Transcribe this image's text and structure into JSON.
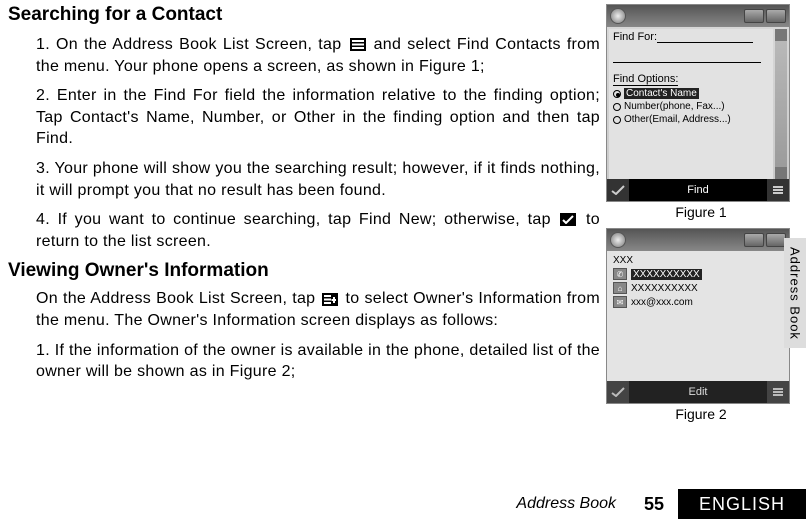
{
  "headings": {
    "searching": "Searching for a Contact",
    "viewing": "Viewing Owner's Information"
  },
  "searching_steps": {
    "s1a": "1. On the Address Book List Screen, tap",
    "s1b": "and select Find Contacts from the menu. Your phone opens a screen, as shown in Figure 1;",
    "s2": "2. Enter in the Find For field the information relative to the finding option; Tap Contact's Name, Number, or Other in the finding option and then tap Find.",
    "s3": "3. Your phone will show you the searching result; however, if it finds nothing, it will prompt you that no result has been found.",
    "s4a": "4. If you want to continue searching, tap Find New; otherwise, tap",
    "s4b": "to return to the list screen."
  },
  "viewing": {
    "p1a": "On the Address Book List Screen, tap",
    "p1b": "to select Owner's Information from the menu. The Owner's Information screen displays as follows:",
    "s1": "1. If the information of the owner is available in the phone, detailed list of the owner will be shown as in Figure 2;"
  },
  "fig1": {
    "find_for_label": "Find For:",
    "find_options_label": "Find Options:",
    "opt1": "Contact's Name",
    "opt2": "Number(phone, Fax...)",
    "opt3": "Other(Email, Address...)",
    "find_btn": "Find",
    "caption": "Figure 1"
  },
  "fig2": {
    "name": "XXX",
    "phone1": "XXXXXXXXXX",
    "phone2": "XXXXXXXXXX",
    "email": "xxx@xxx.com",
    "edit_btn": "Edit",
    "caption": "Figure 2"
  },
  "side_tab": "Address Book",
  "footer": {
    "section": "Address Book",
    "page": "55",
    "lang": "ENGLISH"
  }
}
